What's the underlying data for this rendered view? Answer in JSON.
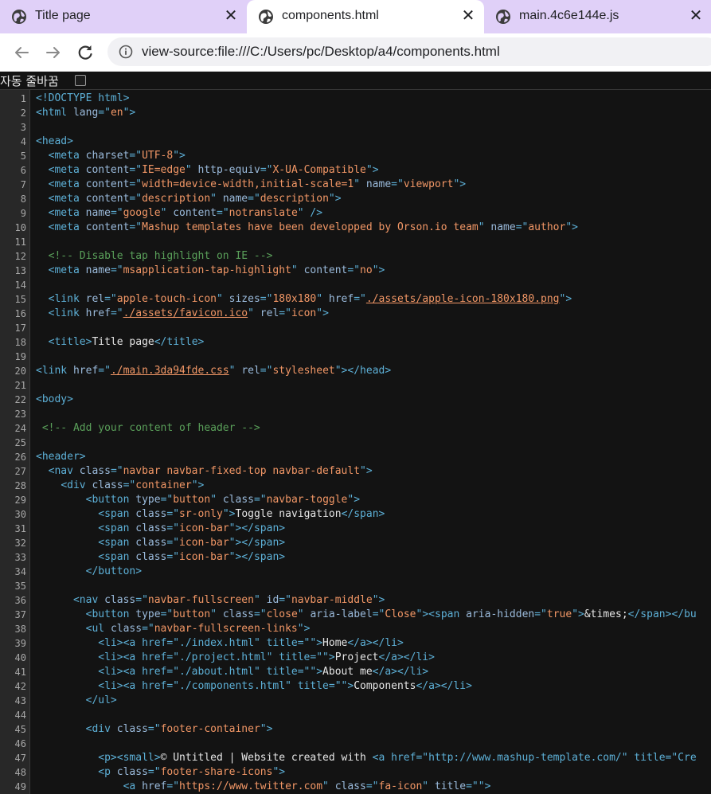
{
  "tabs": [
    {
      "title": "Title page",
      "active": false
    },
    {
      "title": "components.html",
      "active": true
    },
    {
      "title": "main.4c6e144e.js",
      "active": false
    }
  ],
  "toolbar": {
    "url": "view-source:file:///C:/Users/pc/Desktop/a4/components.html"
  },
  "wrap_option": {
    "label": "자동 줄바꿈",
    "checked": false
  },
  "line_numbers": [
    "1",
    "2",
    "3",
    "4",
    "5",
    "6",
    "7",
    "8",
    "9",
    "10",
    "11",
    "12",
    "13",
    "14",
    "15",
    "16",
    "17",
    "18",
    "19",
    "20",
    "21",
    "22",
    "23",
    "24",
    "25",
    "26",
    "27",
    "28",
    "29",
    "30",
    "31",
    "32",
    "33",
    "34",
    "35",
    "36",
    "37",
    "38",
    "39",
    "40",
    "41",
    "42",
    "43",
    "44",
    "45",
    "46",
    "47",
    "48",
    "49"
  ],
  "colors": {
    "tag": "#5db0d7",
    "attribute": "#9bbbdc",
    "value": "#f29766",
    "comment": "#5aa05a",
    "text": "#e6e6e6",
    "tabbar": "#e0d0f8"
  },
  "source_lines": [
    [
      {
        "k": "t",
        "s": "<!DOCTYPE html>"
      }
    ],
    [
      {
        "k": "t",
        "s": "<html "
      },
      {
        "k": "a",
        "s": "lang"
      },
      {
        "k": "t",
        "s": "=\""
      },
      {
        "k": "v",
        "s": "en"
      },
      {
        "k": "t",
        "s": "\">"
      }
    ],
    [],
    [
      {
        "k": "t",
        "s": "<head>"
      }
    ],
    [
      {
        "k": "x",
        "s": "  "
      },
      {
        "k": "t",
        "s": "<meta "
      },
      {
        "k": "a",
        "s": "charset"
      },
      {
        "k": "t",
        "s": "=\""
      },
      {
        "k": "v",
        "s": "UTF-8"
      },
      {
        "k": "t",
        "s": "\">"
      }
    ],
    [
      {
        "k": "x",
        "s": "  "
      },
      {
        "k": "t",
        "s": "<meta "
      },
      {
        "k": "a",
        "s": "content"
      },
      {
        "k": "t",
        "s": "=\""
      },
      {
        "k": "v",
        "s": "IE=edge"
      },
      {
        "k": "t",
        "s": "\" "
      },
      {
        "k": "a",
        "s": "http-equiv"
      },
      {
        "k": "t",
        "s": "=\""
      },
      {
        "k": "v",
        "s": "X-UA-Compatible"
      },
      {
        "k": "t",
        "s": "\">"
      }
    ],
    [
      {
        "k": "x",
        "s": "  "
      },
      {
        "k": "t",
        "s": "<meta "
      },
      {
        "k": "a",
        "s": "content"
      },
      {
        "k": "t",
        "s": "=\""
      },
      {
        "k": "v",
        "s": "width=device-width,initial-scale=1"
      },
      {
        "k": "t",
        "s": "\" "
      },
      {
        "k": "a",
        "s": "name"
      },
      {
        "k": "t",
        "s": "=\""
      },
      {
        "k": "v",
        "s": "viewport"
      },
      {
        "k": "t",
        "s": "\">"
      }
    ],
    [
      {
        "k": "x",
        "s": "  "
      },
      {
        "k": "t",
        "s": "<meta "
      },
      {
        "k": "a",
        "s": "content"
      },
      {
        "k": "t",
        "s": "=\""
      },
      {
        "k": "v",
        "s": "description"
      },
      {
        "k": "t",
        "s": "\" "
      },
      {
        "k": "a",
        "s": "name"
      },
      {
        "k": "t",
        "s": "=\""
      },
      {
        "k": "v",
        "s": "description"
      },
      {
        "k": "t",
        "s": "\">"
      }
    ],
    [
      {
        "k": "x",
        "s": "  "
      },
      {
        "k": "t",
        "s": "<meta "
      },
      {
        "k": "a",
        "s": "name"
      },
      {
        "k": "t",
        "s": "=\""
      },
      {
        "k": "v",
        "s": "google"
      },
      {
        "k": "t",
        "s": "\" "
      },
      {
        "k": "a",
        "s": "content"
      },
      {
        "k": "t",
        "s": "=\""
      },
      {
        "k": "v",
        "s": "notranslate"
      },
      {
        "k": "t",
        "s": "\" />"
      }
    ],
    [
      {
        "k": "x",
        "s": "  "
      },
      {
        "k": "t",
        "s": "<meta "
      },
      {
        "k": "a",
        "s": "content"
      },
      {
        "k": "t",
        "s": "=\""
      },
      {
        "k": "v",
        "s": "Mashup templates have been developped by Orson.io team"
      },
      {
        "k": "t",
        "s": "\" "
      },
      {
        "k": "a",
        "s": "name"
      },
      {
        "k": "t",
        "s": "=\""
      },
      {
        "k": "v",
        "s": "author"
      },
      {
        "k": "t",
        "s": "\">"
      }
    ],
    [],
    [
      {
        "k": "x",
        "s": "  "
      },
      {
        "k": "c",
        "s": "<!-- Disable tap highlight on IE -->"
      }
    ],
    [
      {
        "k": "x",
        "s": "  "
      },
      {
        "k": "t",
        "s": "<meta "
      },
      {
        "k": "a",
        "s": "name"
      },
      {
        "k": "t",
        "s": "=\""
      },
      {
        "k": "v",
        "s": "msapplication-tap-highlight"
      },
      {
        "k": "t",
        "s": "\" "
      },
      {
        "k": "a",
        "s": "content"
      },
      {
        "k": "t",
        "s": "=\""
      },
      {
        "k": "v",
        "s": "no"
      },
      {
        "k": "t",
        "s": "\">"
      }
    ],
    [],
    [
      {
        "k": "x",
        "s": "  "
      },
      {
        "k": "t",
        "s": "<link "
      },
      {
        "k": "a",
        "s": "rel"
      },
      {
        "k": "t",
        "s": "=\""
      },
      {
        "k": "v",
        "s": "apple-touch-icon"
      },
      {
        "k": "t",
        "s": "\" "
      },
      {
        "k": "a",
        "s": "sizes"
      },
      {
        "k": "t",
        "s": "=\""
      },
      {
        "k": "v",
        "s": "180x180"
      },
      {
        "k": "t",
        "s": "\" "
      },
      {
        "k": "a",
        "s": "href"
      },
      {
        "k": "t",
        "s": "=\""
      },
      {
        "k": "lk",
        "s": "./assets/apple-icon-180x180.png"
      },
      {
        "k": "t",
        "s": "\">"
      }
    ],
    [
      {
        "k": "x",
        "s": "  "
      },
      {
        "k": "t",
        "s": "<link "
      },
      {
        "k": "a",
        "s": "href"
      },
      {
        "k": "t",
        "s": "=\""
      },
      {
        "k": "lk",
        "s": "./assets/favicon.ico"
      },
      {
        "k": "t",
        "s": "\" "
      },
      {
        "k": "a",
        "s": "rel"
      },
      {
        "k": "t",
        "s": "=\""
      },
      {
        "k": "v",
        "s": "icon"
      },
      {
        "k": "t",
        "s": "\">"
      }
    ],
    [],
    [
      {
        "k": "x",
        "s": "  "
      },
      {
        "k": "t",
        "s": "<title>"
      },
      {
        "k": "x",
        "s": "Title page"
      },
      {
        "k": "t",
        "s": "</title>"
      }
    ],
    [],
    [
      {
        "k": "t",
        "s": "<link "
      },
      {
        "k": "a",
        "s": "href"
      },
      {
        "k": "t",
        "s": "=\""
      },
      {
        "k": "lk",
        "s": "./main.3da94fde.css"
      },
      {
        "k": "t",
        "s": "\" "
      },
      {
        "k": "a",
        "s": "rel"
      },
      {
        "k": "t",
        "s": "=\""
      },
      {
        "k": "v",
        "s": "stylesheet"
      },
      {
        "k": "t",
        "s": "\"></head>"
      }
    ],
    [],
    [
      {
        "k": "t",
        "s": "<body>"
      }
    ],
    [],
    [
      {
        "k": "x",
        "s": " "
      },
      {
        "k": "c",
        "s": "<!-- Add your content of header -->"
      }
    ],
    [],
    [
      {
        "k": "t",
        "s": "<header>"
      }
    ],
    [
      {
        "k": "x",
        "s": "  "
      },
      {
        "k": "t",
        "s": "<nav "
      },
      {
        "k": "a",
        "s": "class"
      },
      {
        "k": "t",
        "s": "=\""
      },
      {
        "k": "v",
        "s": "navbar navbar-fixed-top navbar-default"
      },
      {
        "k": "t",
        "s": "\">"
      }
    ],
    [
      {
        "k": "x",
        "s": "    "
      },
      {
        "k": "t",
        "s": "<div "
      },
      {
        "k": "a",
        "s": "class"
      },
      {
        "k": "t",
        "s": "=\""
      },
      {
        "k": "v",
        "s": "container"
      },
      {
        "k": "t",
        "s": "\">"
      }
    ],
    [
      {
        "k": "x",
        "s": "        "
      },
      {
        "k": "t",
        "s": "<button "
      },
      {
        "k": "a",
        "s": "type"
      },
      {
        "k": "t",
        "s": "=\""
      },
      {
        "k": "v",
        "s": "button"
      },
      {
        "k": "t",
        "s": "\" "
      },
      {
        "k": "a",
        "s": "class"
      },
      {
        "k": "t",
        "s": "=\""
      },
      {
        "k": "v",
        "s": "navbar-toggle"
      },
      {
        "k": "t",
        "s": "\">"
      }
    ],
    [
      {
        "k": "x",
        "s": "          "
      },
      {
        "k": "t",
        "s": "<span "
      },
      {
        "k": "a",
        "s": "class"
      },
      {
        "k": "t",
        "s": "=\""
      },
      {
        "k": "v",
        "s": "sr-only"
      },
      {
        "k": "t",
        "s": "\">"
      },
      {
        "k": "x",
        "s": "Toggle navigation"
      },
      {
        "k": "t",
        "s": "</span>"
      }
    ],
    [
      {
        "k": "x",
        "s": "          "
      },
      {
        "k": "t",
        "s": "<span "
      },
      {
        "k": "a",
        "s": "class"
      },
      {
        "k": "t",
        "s": "=\""
      },
      {
        "k": "v",
        "s": "icon-bar"
      },
      {
        "k": "t",
        "s": "\"></span>"
      }
    ],
    [
      {
        "k": "x",
        "s": "          "
      },
      {
        "k": "t",
        "s": "<span "
      },
      {
        "k": "a",
        "s": "class"
      },
      {
        "k": "t",
        "s": "=\""
      },
      {
        "k": "v",
        "s": "icon-bar"
      },
      {
        "k": "t",
        "s": "\"></span>"
      }
    ],
    [
      {
        "k": "x",
        "s": "          "
      },
      {
        "k": "t",
        "s": "<span "
      },
      {
        "k": "a",
        "s": "class"
      },
      {
        "k": "t",
        "s": "=\""
      },
      {
        "k": "v",
        "s": "icon-bar"
      },
      {
        "k": "t",
        "s": "\"></span>"
      }
    ],
    [
      {
        "k": "x",
        "s": "        "
      },
      {
        "k": "t",
        "s": "</button>"
      }
    ],
    [],
    [
      {
        "k": "x",
        "s": "      "
      },
      {
        "k": "t",
        "s": "<nav "
      },
      {
        "k": "a",
        "s": "class"
      },
      {
        "k": "t",
        "s": "=\""
      },
      {
        "k": "v",
        "s": "navbar-fullscreen"
      },
      {
        "k": "t",
        "s": "\" "
      },
      {
        "k": "a",
        "s": "id"
      },
      {
        "k": "t",
        "s": "=\""
      },
      {
        "k": "v",
        "s": "navbar-middle"
      },
      {
        "k": "t",
        "s": "\">"
      }
    ],
    [
      {
        "k": "x",
        "s": "        "
      },
      {
        "k": "t",
        "s": "<button "
      },
      {
        "k": "a",
        "s": "type"
      },
      {
        "k": "t",
        "s": "=\""
      },
      {
        "k": "v",
        "s": "button"
      },
      {
        "k": "t",
        "s": "\" "
      },
      {
        "k": "a",
        "s": "class"
      },
      {
        "k": "t",
        "s": "=\""
      },
      {
        "k": "v",
        "s": "close"
      },
      {
        "k": "t",
        "s": "\" "
      },
      {
        "k": "a",
        "s": "aria-label"
      },
      {
        "k": "t",
        "s": "=\""
      },
      {
        "k": "v",
        "s": "Close"
      },
      {
        "k": "t",
        "s": "\"><span "
      },
      {
        "k": "a",
        "s": "aria-hidden"
      },
      {
        "k": "t",
        "s": "=\""
      },
      {
        "k": "v",
        "s": "true"
      },
      {
        "k": "t",
        "s": "\">"
      },
      {
        "k": "x",
        "s": "&times;"
      },
      {
        "k": "t",
        "s": "</span></bu"
      }
    ],
    [
      {
        "k": "x",
        "s": "        "
      },
      {
        "k": "t",
        "s": "<ul "
      },
      {
        "k": "a",
        "s": "class"
      },
      {
        "k": "t",
        "s": "=\""
      },
      {
        "k": "v",
        "s": "navbar-fullscreen-links"
      },
      {
        "k": "t",
        "s": "\">"
      }
    ],
    [
      {
        "k": "x",
        "s": "          "
      },
      {
        "k": "t",
        "s": "<li><a href=\"./index.html\" title=\"\">"
      },
      {
        "k": "x",
        "s": "Home"
      },
      {
        "k": "t",
        "s": "</a></li>"
      }
    ],
    [
      {
        "k": "x",
        "s": "          "
      },
      {
        "k": "t",
        "s": "<li><a href=\"./project.html\" title=\"\">"
      },
      {
        "k": "x",
        "s": "Project"
      },
      {
        "k": "t",
        "s": "</a></li>"
      }
    ],
    [
      {
        "k": "x",
        "s": "          "
      },
      {
        "k": "t",
        "s": "<li><a href=\"./about.html\" title=\"\">"
      },
      {
        "k": "x",
        "s": "About me"
      },
      {
        "k": "t",
        "s": "</a></li>"
      }
    ],
    [
      {
        "k": "x",
        "s": "          "
      },
      {
        "k": "t",
        "s": "<li><a href=\"./components.html\" title=\"\">"
      },
      {
        "k": "x",
        "s": "Components"
      },
      {
        "k": "t",
        "s": "</a></li>"
      }
    ],
    [
      {
        "k": "x",
        "s": "        "
      },
      {
        "k": "t",
        "s": "</ul>"
      }
    ],
    [],
    [
      {
        "k": "x",
        "s": "        "
      },
      {
        "k": "t",
        "s": "<div "
      },
      {
        "k": "a",
        "s": "class"
      },
      {
        "k": "t",
        "s": "=\""
      },
      {
        "k": "v",
        "s": "footer-container"
      },
      {
        "k": "t",
        "s": "\">"
      }
    ],
    [],
    [
      {
        "k": "x",
        "s": "          "
      },
      {
        "k": "t",
        "s": "<p><small>"
      },
      {
        "k": "x",
        "s": "© Untitled | Website created with "
      },
      {
        "k": "t",
        "s": "<a href=\"http://www.mashup-template.com/\" title=\"Cre"
      }
    ],
    [
      {
        "k": "x",
        "s": "          "
      },
      {
        "k": "t",
        "s": "<p "
      },
      {
        "k": "a",
        "s": "class"
      },
      {
        "k": "t",
        "s": "=\""
      },
      {
        "k": "v",
        "s": "footer-share-icons"
      },
      {
        "k": "t",
        "s": "\">"
      }
    ],
    [
      {
        "k": "x",
        "s": "              "
      },
      {
        "k": "t",
        "s": "<a "
      },
      {
        "k": "a",
        "s": "href"
      },
      {
        "k": "t",
        "s": "=\""
      },
      {
        "k": "v",
        "s": "https://www.twitter.com"
      },
      {
        "k": "t",
        "s": "\" "
      },
      {
        "k": "a",
        "s": "class"
      },
      {
        "k": "t",
        "s": "=\""
      },
      {
        "k": "v",
        "s": "fa-icon"
      },
      {
        "k": "t",
        "s": "\" "
      },
      {
        "k": "a",
        "s": "title"
      },
      {
        "k": "t",
        "s": "=\""
      },
      {
        "k": "t",
        "s": "\">"
      }
    ]
  ]
}
